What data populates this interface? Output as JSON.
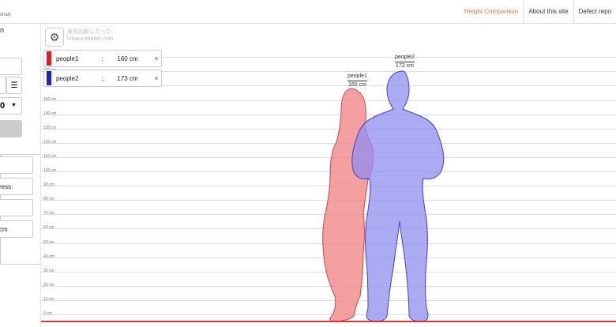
{
  "header": {
    "brand_sub": "chart",
    "nav": [
      "Height Comparison",
      "About this site",
      "Defect repo"
    ]
  },
  "leftpanel": {
    "text_top": "n",
    "list_icon": "list-icon",
    "select_value": "0",
    "field_label": "ress:",
    "unit_text": "cm"
  },
  "chart": {
    "watermark_line1": "身長比較したった",
    "watermark_line2": "hikaku-sitatter.com",
    "yticks": [
      "180 cm",
      "170 cm",
      "160 cm",
      "150 cm",
      "140 cm",
      "130 cm",
      "120 cm",
      "110 cm",
      "100 cm",
      "90 cm",
      "80 cm",
      "70 cm",
      "60 cm",
      "50 cm",
      "40 cm",
      "30 cm",
      "20 cm",
      "10 cm",
      "0 cm"
    ],
    "colors": {
      "people1": "#e02020",
      "people2": "#1a22c8",
      "fill1": "#f08080",
      "fill2": "#8f8ff0",
      "accent": "#e07a3c"
    }
  },
  "people": [
    {
      "name": "people1",
      "height": "160 cm",
      "height_value": 160,
      "color": "#e02020"
    },
    {
      "name": "people2",
      "height": "173 cm",
      "height_value": 173,
      "color": "#1a22c8"
    }
  ]
}
